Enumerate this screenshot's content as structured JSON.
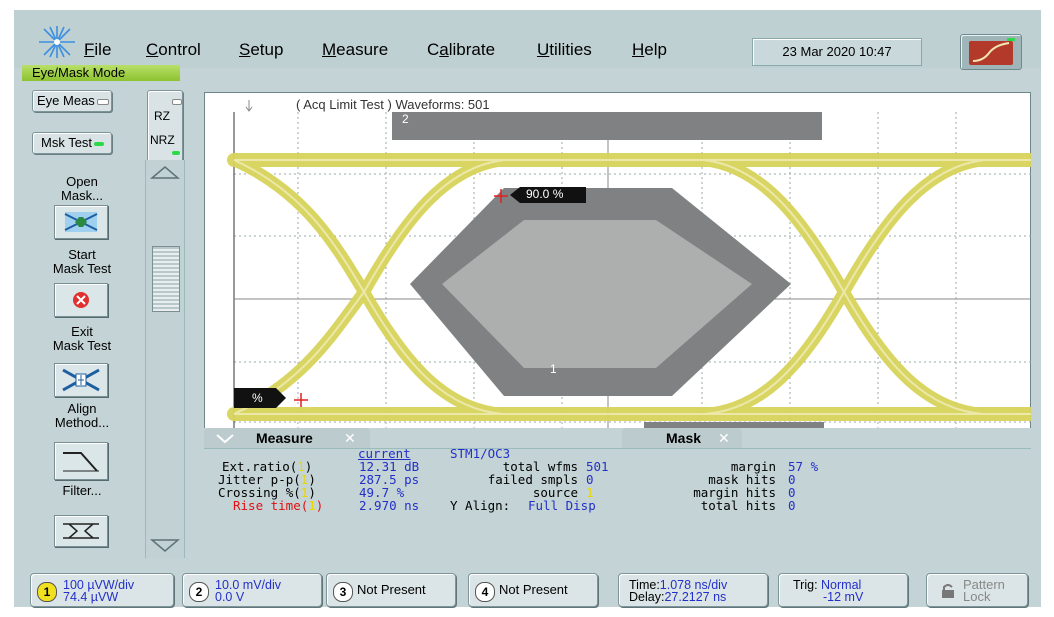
{
  "menu": {
    "items": [
      {
        "label": "File",
        "ul": "F",
        "rest": "ile"
      },
      {
        "label": "Control",
        "ul": "C",
        "rest": "ontrol"
      },
      {
        "label": "Setup",
        "ul": "S",
        "rest": "etup"
      },
      {
        "label": "Measure",
        "ul": "M",
        "rest": "easure"
      },
      {
        "label": "Calibrate",
        "ul": "a",
        "pre": "C",
        "rest": "librate"
      },
      {
        "label": "Utilities",
        "ul": "U",
        "rest": "tilities"
      },
      {
        "label": "Help",
        "ul": "H",
        "rest": "elp"
      }
    ],
    "datetime": "23 Mar 2020   10:47"
  },
  "mode": "Eye/Mask Mode",
  "sidebar": {
    "eye_meas": "Eye Meas",
    "msk_test": "Msk Test",
    "rz": "RZ",
    "nrz": "NRZ",
    "open_mask": "Open\nMask...",
    "start_mask": "Start\nMask Test",
    "exit_mask": "Exit\nMask Test",
    "align": "Align\nMethod...",
    "filter": "Filter..."
  },
  "plot": {
    "header": "( Acq Limit Test )  Waveforms: 501",
    "crossing_label": "90.0 %",
    "left_label": "%",
    "region1": "1",
    "region2": "2"
  },
  "measure": {
    "tab_measure": "Measure",
    "tab_mask": "Mask",
    "col_current": "current",
    "rows": [
      {
        "name": "Ext.ratio(",
        "ch": "1",
        "value": "12.31 dB"
      },
      {
        "name": "Jitter p-p(",
        "ch": "1",
        "value": "287.5 ps"
      },
      {
        "name": "Crossing %(",
        "ch": "1",
        "value": "49.7 %"
      },
      {
        "name": "Rise time(",
        "ch": "1",
        "value": "2.970 ns"
      }
    ],
    "mask_std": "STM1/OC3",
    "mask_rows": [
      {
        "label": "total wfms",
        "value": "501"
      },
      {
        "label": "failed smpls",
        "value": "0"
      },
      {
        "label": "source",
        "value": "1"
      },
      {
        "label": "Y Align:",
        "value": "Full Disp"
      }
    ],
    "hits_rows": [
      {
        "label": "margin",
        "value": "57 %"
      },
      {
        "label": "mask hits",
        "value": "0"
      },
      {
        "label": "margin hits",
        "value": "0"
      },
      {
        "label": "total hits",
        "value": "0"
      }
    ]
  },
  "bottom": {
    "ch1": {
      "num": "1",
      "line1": "100 µVW/div",
      "line2": "74.4 µVW"
    },
    "ch2": {
      "num": "2",
      "line1": "10.0 mV/div",
      "line2": "0.0 V"
    },
    "ch3": {
      "num": "3",
      "label": "Not Present"
    },
    "ch4": {
      "num": "4",
      "label": "Not Present"
    },
    "time": {
      "l1a": "Time:",
      "l1b": "1.078 ns/div",
      "l2a": "Delay:",
      "l2b": "27.2127 ns"
    },
    "trig": {
      "l1a": "Trig: ",
      "l1b": "Normal",
      "l2": "-12 mV"
    },
    "pattern": {
      "l1": "Pattern",
      "l2": "Lock"
    }
  },
  "colors": {
    "eye": "#d8d35a",
    "mask_outer": "#7f8182",
    "mask_inner": "#adaeae",
    "ch1": "#f0e020",
    "led": "#2bd94a"
  }
}
